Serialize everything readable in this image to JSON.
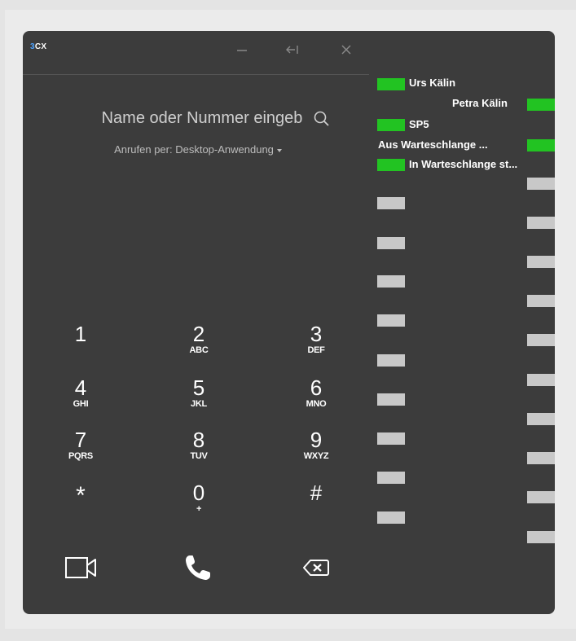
{
  "app": {
    "brand_prefix": "3",
    "brand_suffix": "CX",
    "window_controls": [
      "minimize-icon",
      "dock-icon",
      "close-icon"
    ]
  },
  "search": {
    "placeholder": "Name oder Nummer eingeb",
    "icon": "search-icon"
  },
  "call_via": {
    "label": "Anrufen per: Desktop-Anwendung"
  },
  "keypad": [
    {
      "digit": "1",
      "letters": ""
    },
    {
      "digit": "2",
      "letters": "ABC"
    },
    {
      "digit": "3",
      "letters": "DEF"
    },
    {
      "digit": "4",
      "letters": "GHI"
    },
    {
      "digit": "5",
      "letters": "JKL"
    },
    {
      "digit": "6",
      "letters": "MNO"
    },
    {
      "digit": "7",
      "letters": "PQRS"
    },
    {
      "digit": "8",
      "letters": "TUV"
    },
    {
      "digit": "9",
      "letters": "WXYZ"
    },
    {
      "digit": "*",
      "letters": ""
    },
    {
      "digit": "0",
      "letters": "+"
    },
    {
      "digit": "#",
      "letters": ""
    }
  ],
  "actions": [
    "video-call-icon",
    "phone-icon",
    "backspace-icon"
  ],
  "blf": {
    "left_labels": [
      "Urs Kälin",
      "SP5",
      "In Warteschlange st..."
    ],
    "right_labels": [
      "Petra Kälin",
      "Aus Warteschlange ..."
    ],
    "status_colors": {
      "available": "#22c322",
      "unassigned": "#c8c8c8"
    }
  }
}
